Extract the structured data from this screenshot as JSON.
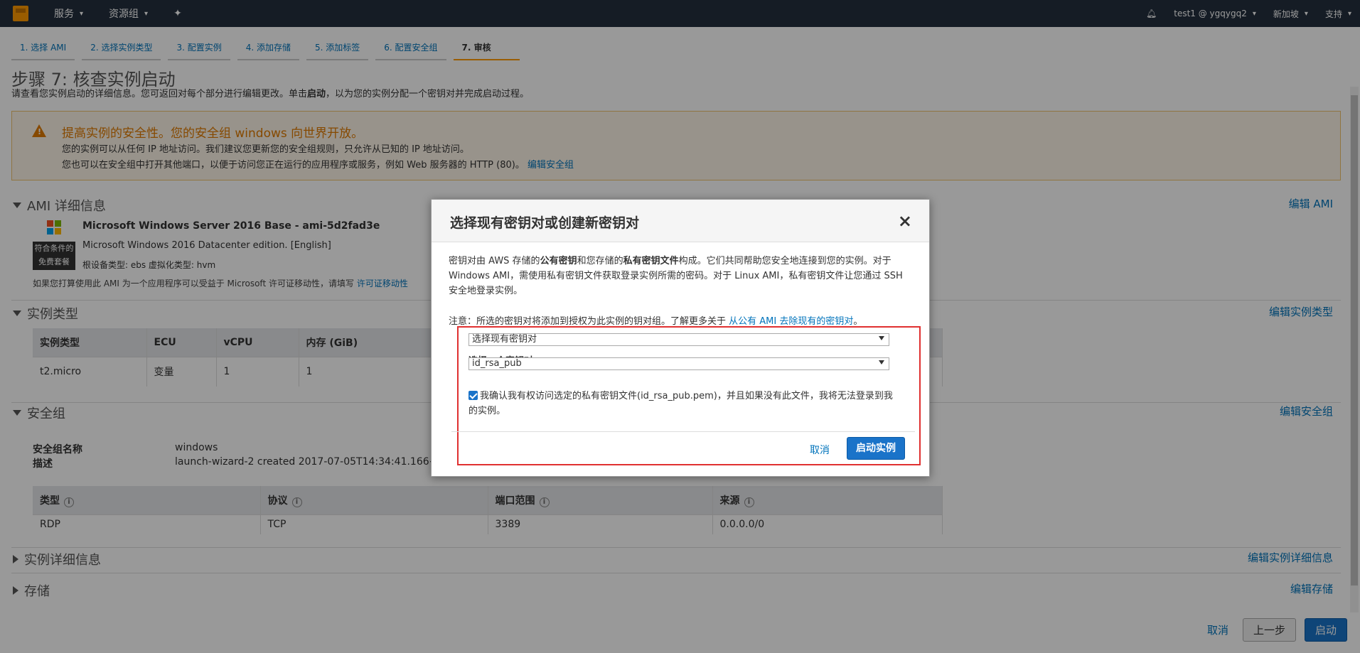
{
  "topnav": {
    "services": "服务",
    "resource_groups": "资源组",
    "user": "test1 @ ygqygq2",
    "region": "新加坡",
    "support": "支持"
  },
  "steps": [
    "1. 选择 AMI",
    "2. 选择实例类型",
    "3. 配置实例",
    "4. 添加存储",
    "5. 添加标签",
    "6. 配置安全组",
    "7. 审核"
  ],
  "page": {
    "title": "步骤 7: 核查实例启动",
    "subtitle_pre": "请查看您实例启动的详细信息。您可返回对每个部分进行编辑更改。单击",
    "subtitle_bold": "启动",
    "subtitle_post": "，以为您的实例分配一个密钥对并完成启动过程。"
  },
  "warning": {
    "title": "提高实例的安全性。您的安全组 windows 向世界开放。",
    "line1": "您的实例可以从任何 IP 地址访问。我们建议您更新您的安全组规则，只允许从已知的 IP 地址访问。",
    "line2": "您也可以在安全组中打开其他端口，以便于访问您正在运行的应用程序或服务，例如 Web 服务器的 HTTP (80)。",
    "link": "编辑安全组"
  },
  "ami": {
    "section": "AMI 详细信息",
    "edit": "编辑 AMI",
    "badge_line1": "符合条件的",
    "badge_line2": "免费套餐",
    "name": "Microsoft Windows Server 2016 Base - ami-5d2fad3e",
    "desc": "Microsoft Windows 2016 Datacenter edition. [English]",
    "meta": "根设备类型: ebs      虚拟化类型: hvm",
    "note": "如果您打算使用此 AMI 为一个应用程序可以受益于 Microsoft 许可证移动性，请填写",
    "note_link": "许可证移动性"
  },
  "instance_type": {
    "section": "实例类型",
    "edit": "编辑实例类型",
    "headers": [
      "实例类型",
      "ECU",
      "vCPU",
      "内存 (GiB)"
    ],
    "row": [
      "t2.micro",
      "变量",
      "1",
      "1"
    ]
  },
  "security_group": {
    "section": "安全组",
    "edit": "编辑安全组",
    "name_label": "安全组名称",
    "name_value": "windows",
    "desc_label": "描述",
    "desc_value": "launch-wizard-2 created 2017-07-05T14:34:41.166+08:00",
    "headers": [
      "类型",
      "协议",
      "端口范围",
      "来源"
    ],
    "row": [
      "RDP",
      "TCP",
      "3389",
      "0.0.0.0/0"
    ]
  },
  "instance_details": {
    "section": "实例详细信息",
    "edit": "编辑实例详细信息"
  },
  "storage": {
    "section": "存储",
    "edit": "编辑存储"
  },
  "footer": {
    "cancel": "取消",
    "previous": "上一步",
    "launch": "启动"
  },
  "modal": {
    "title": "选择现有密钥对或创建新密钥对",
    "close": "×",
    "body_1": "密钥对由 AWS 存储的",
    "body_b1": "公有密钥",
    "body_2": "和您存储的",
    "body_b2": "私有密钥文件",
    "body_3": "构成。它们共同帮助您安全地连接到您的实例。对于 Windows AMI，需使用私有密钥文件获取登录实例所需的密码。对于 Linux AMI，私有密钥文件让您通过 SSH 安全地登录实例。",
    "note": "注意：所选的密钥对将添加到授权为此实例的钥对组。了解更多关于",
    "note_link": "从公有 AMI 去除现有的密钥对",
    "note_end": "。",
    "select_mode": "选择现有密钥对",
    "select_label": "选择一个密钥对",
    "key_value": "id_rsa_pub",
    "ack": "我确认我有权访问选定的私有密钥文件(id_rsa_pub.pem)，并且如果没有此文件，我将无法登录到我的实例。",
    "cancel": "取消",
    "launch": "启动实例"
  }
}
